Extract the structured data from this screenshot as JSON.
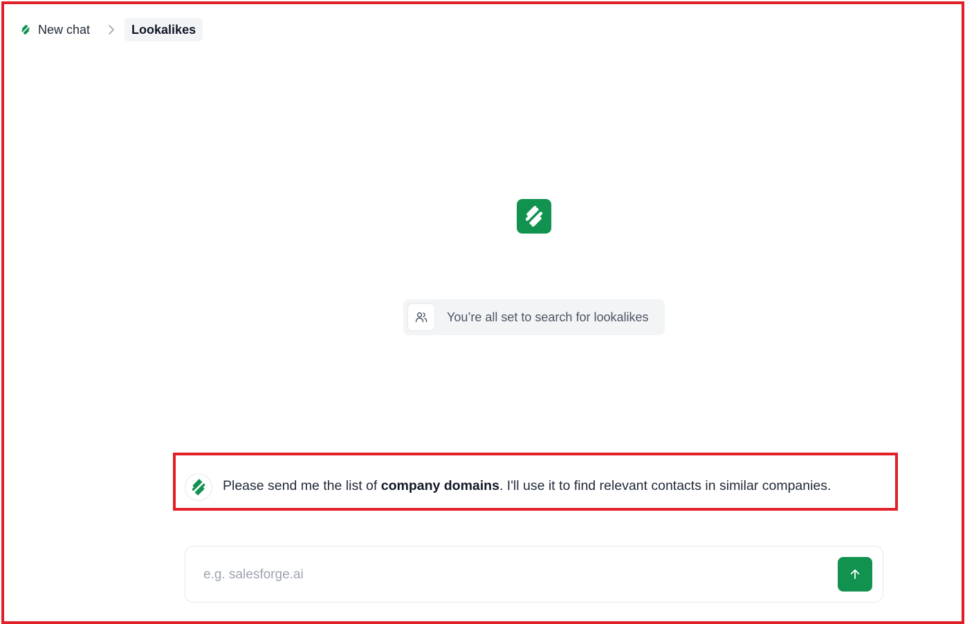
{
  "breadcrumb": {
    "new_chat_label": "New chat",
    "separator_icon": "chevron-right-icon",
    "current_label": "Lookalikes"
  },
  "brand": {
    "logo_icon": "salesforge-logo-icon",
    "accent_color": "#12924f"
  },
  "status": {
    "icon": "users-icon",
    "text": "You’re all set to search for lookalikes"
  },
  "message": {
    "avatar_icon": "salesforge-logo-icon",
    "text_before": "Please send me the list of ",
    "text_bold": "company domains",
    "text_after": ". I'll use it to find relevant contacts in similar companies."
  },
  "composer": {
    "placeholder": "e.g. salesforge.ai",
    "value": "",
    "send_icon": "arrow-up-icon"
  },
  "colors": {
    "highlight_border": "#e01f26"
  }
}
